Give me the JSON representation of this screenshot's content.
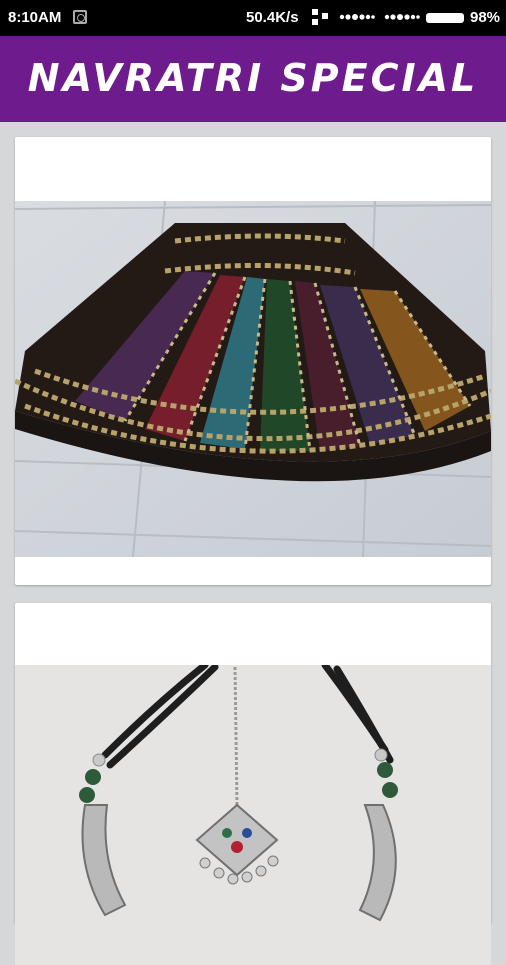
{
  "status_bar": {
    "time": "8:10AM",
    "network_speed": "50.4K/s",
    "battery": "98%",
    "icons": [
      "notification-icon",
      "data-transfer-icon",
      "signal-icon",
      "signal-icon",
      "battery-icon"
    ]
  },
  "app_bar": {
    "title": "NAVRATRI SPECIAL",
    "color": "#6e1c8d"
  },
  "feed": {
    "items": [
      {
        "subject": "embroidered mirror-work skirt (chaniya)"
      },
      {
        "subject": "oxidised silver necklace with pendant"
      }
    ]
  }
}
